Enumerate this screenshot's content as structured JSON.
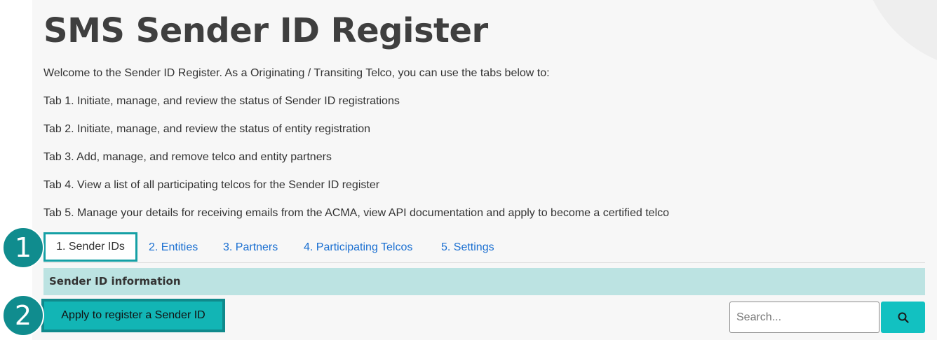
{
  "page": {
    "title": "SMS Sender ID Register",
    "intro": "Welcome to the Sender ID Register. As a Originating / Transiting Telco, you can use the tabs below to:",
    "tab_descriptions": [
      "Tab 1. Initiate, manage, and review the status of Sender ID registrations",
      "Tab 2. Initiate, manage, and review the status of entity registration",
      "Tab 3. Add, manage, and remove telco and entity partners",
      "Tab 4. View a list of all participating telcos for the Sender ID register",
      "Tab 5. Manage your details for receiving emails from the ACMA, view API documentation and apply to become a certified telco"
    ]
  },
  "tabs": [
    {
      "label": "1. Sender IDs",
      "active": true
    },
    {
      "label": "2. Entities",
      "active": false
    },
    {
      "label": "3. Partners",
      "active": false
    },
    {
      "label": "4. Participating Telcos",
      "active": false
    },
    {
      "label": "5. Settings",
      "active": false
    }
  ],
  "section": {
    "header": "Sender ID information",
    "apply_button_label": "Apply to register a Sender ID"
  },
  "search": {
    "placeholder": "Search...",
    "value": "",
    "button_icon": "search-icon"
  },
  "annotations": [
    "1",
    "2"
  ],
  "colors": {
    "accent_teal": "#12b5b5",
    "accent_border": "#108a8c",
    "section_header_bg": "#bce3e2",
    "link_blue": "#1a6fd1",
    "title_text": "#3f3f3f"
  }
}
